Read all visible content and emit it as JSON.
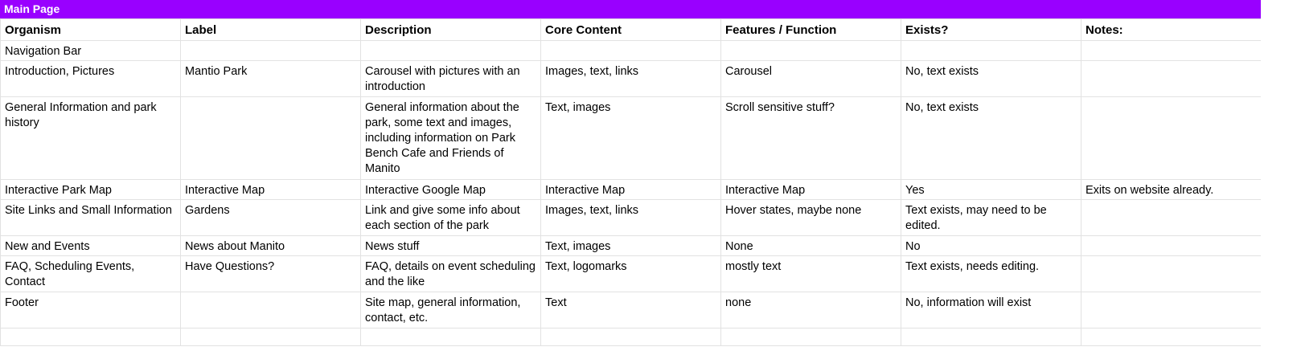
{
  "sheet": {
    "title": "Main Page",
    "header_color": "#9900ff",
    "columns": [
      "Organism",
      "Label",
      "Description",
      "Core Content",
      "Features / Function",
      "Exists?",
      "Notes:"
    ],
    "rows": [
      [
        "Navigation Bar",
        "",
        "",
        "",
        "",
        "",
        ""
      ],
      [
        "Introduction, Pictures",
        "Mantio Park",
        "Carousel with pictures with an introduction",
        "Images, text, links",
        "Carousel",
        "No, text exists",
        ""
      ],
      [
        "General Information and park history",
        "",
        "General information about the park, some text and images, including information on Park Bench Cafe and Friends of Manito",
        "Text, images",
        "Scroll sensitive stuff?",
        "No, text exists",
        ""
      ],
      [
        "Interactive Park Map",
        "Interactive Map",
        "Interactive Google Map",
        "Interactive Map",
        "Interactive Map",
        "Yes",
        "Exits on website already."
      ],
      [
        "Site Links and Small Information",
        "Gardens",
        "Link and give some info about each section of the park",
        "Images, text, links",
        "Hover states, maybe none",
        "Text exists, may need to be edited.",
        ""
      ],
      [
        "New and Events",
        "News about Manito",
        "News stuff",
        "Text, images",
        "None",
        "No",
        ""
      ],
      [
        "FAQ, Scheduling Events, Contact",
        "Have Questions?",
        "FAQ, details on event scheduling and the like",
        "Text, logomarks",
        "mostly text",
        "Text exists, needs editing.",
        ""
      ],
      [
        "Footer",
        "",
        "Site map, general information, contact, etc.",
        "Text",
        "none",
        "No, information will exist",
        ""
      ],
      [
        "",
        "",
        "",
        "",
        "",
        "",
        ""
      ]
    ]
  }
}
